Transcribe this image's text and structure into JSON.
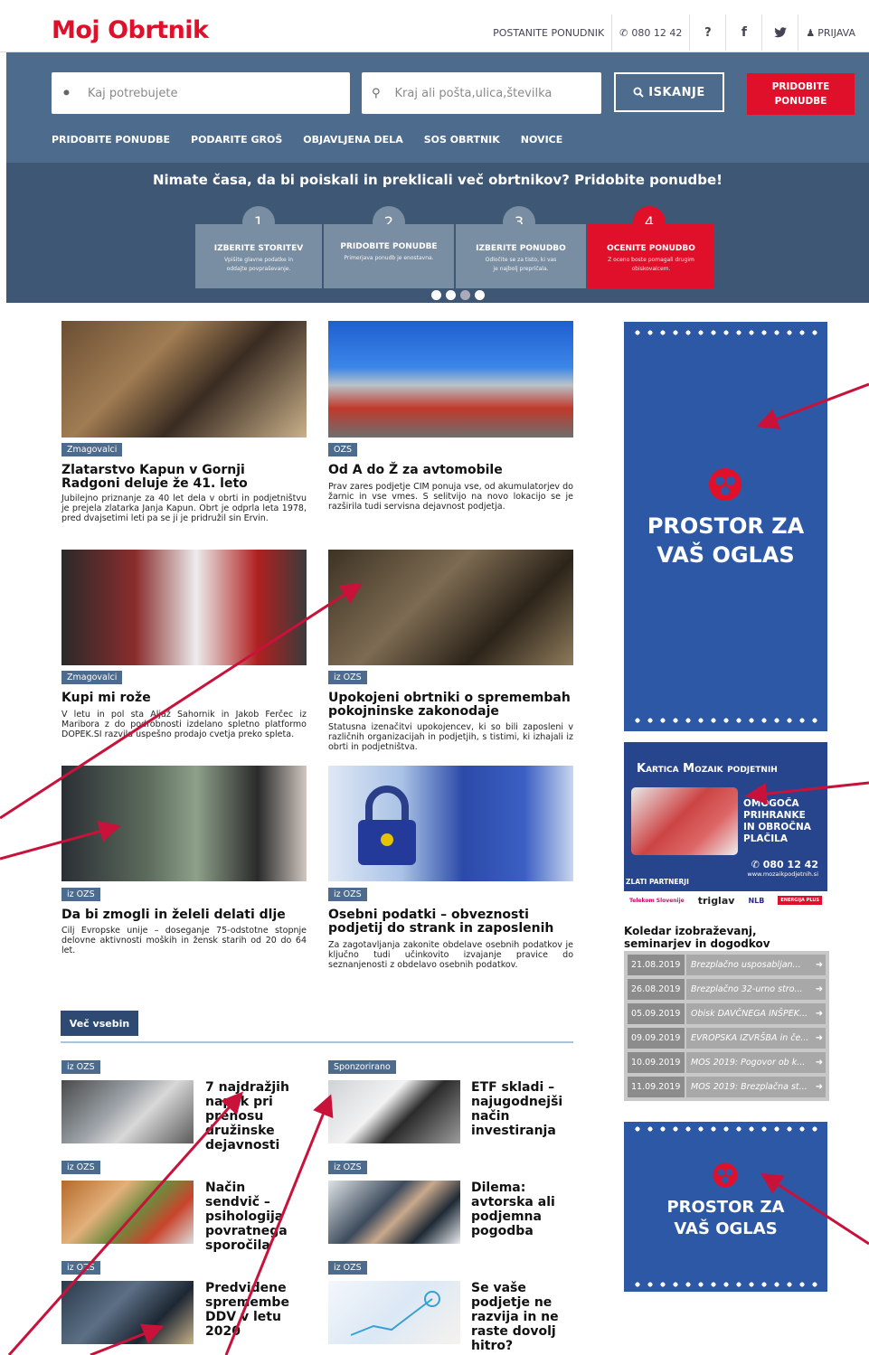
{
  "topbar": {
    "logo": "Moj Obrtnik",
    "nav": {
      "become_provider": "POSTANITE PONUDNIK",
      "phone": "080 12 42",
      "help": "?",
      "login": "PRIJAVA"
    }
  },
  "search": {
    "what_placeholder": "Kaj potrebujete",
    "where_placeholder": "Kraj ali pošta,ulica,številka",
    "search_button": "ISKANJE",
    "offers_button": "PRIDOBITE PONUDBE"
  },
  "main_nav": [
    "PRIDOBITE PONUDBE",
    "PODARITE GROŠ",
    "OBJAVLJENA DELA",
    "SOS OBRTNIK",
    "NOVICE"
  ],
  "hero": {
    "title": "Nimate časa, da bi poiskali in preklicali več obrtnikov? Pridobite ponudbe!",
    "steps": [
      {
        "num": "1",
        "title": "IZBERITE STORITEV",
        "desc": "Vpišite glavne podatke in oddajte povpraševanje."
      },
      {
        "num": "2",
        "title": "PRIDOBITE PONUDBE",
        "desc": "Primerjava ponudb je enostavna."
      },
      {
        "num": "3",
        "title": "IZBERITE PONUDBO",
        "desc": "Odločite se za tisto, ki vas je najbolj prepričala."
      },
      {
        "num": "4",
        "title": "OCENITE PONUDBO",
        "desc": "Z oceno boste pomagali drugim obiskovalcem."
      }
    ]
  },
  "articles": [
    {
      "tag": "Zmagovalci",
      "title": "Zlatarstvo Kapun v Gornji Radgoni deluje že 41. leto",
      "excerpt": "Jubilejno priznanje za 40 let dela v obrti in podjetništvu je prejela zlatarka Janja Kapun. Obrt je odprla leta 1978, pred dvajsetimi leti pa se ji je pridružil sin Ervin."
    },
    {
      "tag": "OZS",
      "title": "Od A do Ž za avtomobile",
      "excerpt": "Prav zares podjetje CIM ponuja vse, od akumulatorjev do žarnic in vse vmes. S selitvijo na novo lokacijo se je razširila tudi servisna dejavnost podjetja."
    },
    {
      "tag": "Zmagovalci",
      "title": "Kupi mi rože",
      "excerpt": "V letu in pol sta Aljaž Sahornik in Jakob Ferčec iz Maribora z do podrobnosti izdelano spletno platformo DOPEK.SI razvila uspešno prodajo cvetja preko spleta."
    },
    {
      "tag": "iz OZS",
      "title": "Upokojeni obrtniki o spremembah pokojninske zakonodaje",
      "excerpt": "Statusna izenačitvi upokojencev, ki so bili zaposleni v različnih organizacijah in podjetjih, s tistimi, ki izhajali iz obrti in podjetništva."
    },
    {
      "tag": "iz OZS",
      "title": "Da bi zmogli in želeli delati dlje",
      "excerpt": "Cilj Evropske unije – doseganje 75-odstotne stopnje delovne aktivnosti moških in žensk starih od 20 do 64 let."
    },
    {
      "tag": "iz OZS",
      "title": "Osebni podatki – obveznosti podjetij do strank in zaposlenih",
      "excerpt": "Za zagotavljanja zakonite obdelave osebnih podatkov je ključno tudi učinkovito izvajanje pravice do seznanjenosti z obdelavo osebnih podatkov."
    }
  ],
  "more_button": "Več vsebin",
  "small_articles": [
    {
      "tag": "iz OZS",
      "title": "7 najdražjih napak pri prenosu družinske dejavnosti"
    },
    {
      "tag": "Sponzorirano",
      "title": "ETF skladi – najugodnejši način investiranja"
    },
    {
      "tag": "iz OZS",
      "title": "Način sendvič – psihologija povratnega sporočila"
    },
    {
      "tag": "iz OZS",
      "title": "Dilema: avtorska ali podjemna pogodba"
    },
    {
      "tag": "iz OZS",
      "title": "Predvidene spremembe DDV v letu 2020"
    },
    {
      "tag": "iz OZS",
      "title": "Se vaše podjetje ne razvija in ne raste dovolj hitro?"
    }
  ],
  "sidebar": {
    "ad_top": {
      "line1": "PROSTOR ZA",
      "line2": "VAŠ OGLAS"
    },
    "card": {
      "title": "Kartica Mozaik podjetnih",
      "text": [
        "OMOGOČA",
        "PRIHRANKE",
        "IN OBROČNA",
        "PLAČILA"
      ],
      "phone": "080 12 42",
      "url": "www.mozaikpodjetnih.si",
      "partners_label": "ZLATI PARTNERJI",
      "partners": [
        "Telekom Slovenije",
        "triglav",
        "NLB",
        "ENERGIJA PLUS"
      ]
    },
    "events_title": "Koledar izobraževanj, seminarjev in dogodkov",
    "events": [
      {
        "date": "21.08.2019",
        "title": "Brezplačno usposabljan..."
      },
      {
        "date": "26.08.2019",
        "title": "Brezplačno 32-urno stro..."
      },
      {
        "date": "05.09.2019",
        "title": "Obisk DAVČNEGA INŠPEK..."
      },
      {
        "date": "09.09.2019",
        "title": "EVROPSKA IZVRŠBA in če..."
      },
      {
        "date": "10.09.2019",
        "title": "MOS 2019: Pogovor ob k..."
      },
      {
        "date": "11.09.2019",
        "title": "MOS 2019: Brezplačna st..."
      }
    ],
    "ad_bottom": {
      "line1": "PROSTOR ZA",
      "line2": "VAŠ OGLAS"
    }
  },
  "colors": {
    "brand_red": "#e0102a",
    "header_blue": "#4d6b8d",
    "hero_blue": "#3e5775",
    "ad_blue": "#2d58a6",
    "annotation_red": "#c8123a"
  }
}
